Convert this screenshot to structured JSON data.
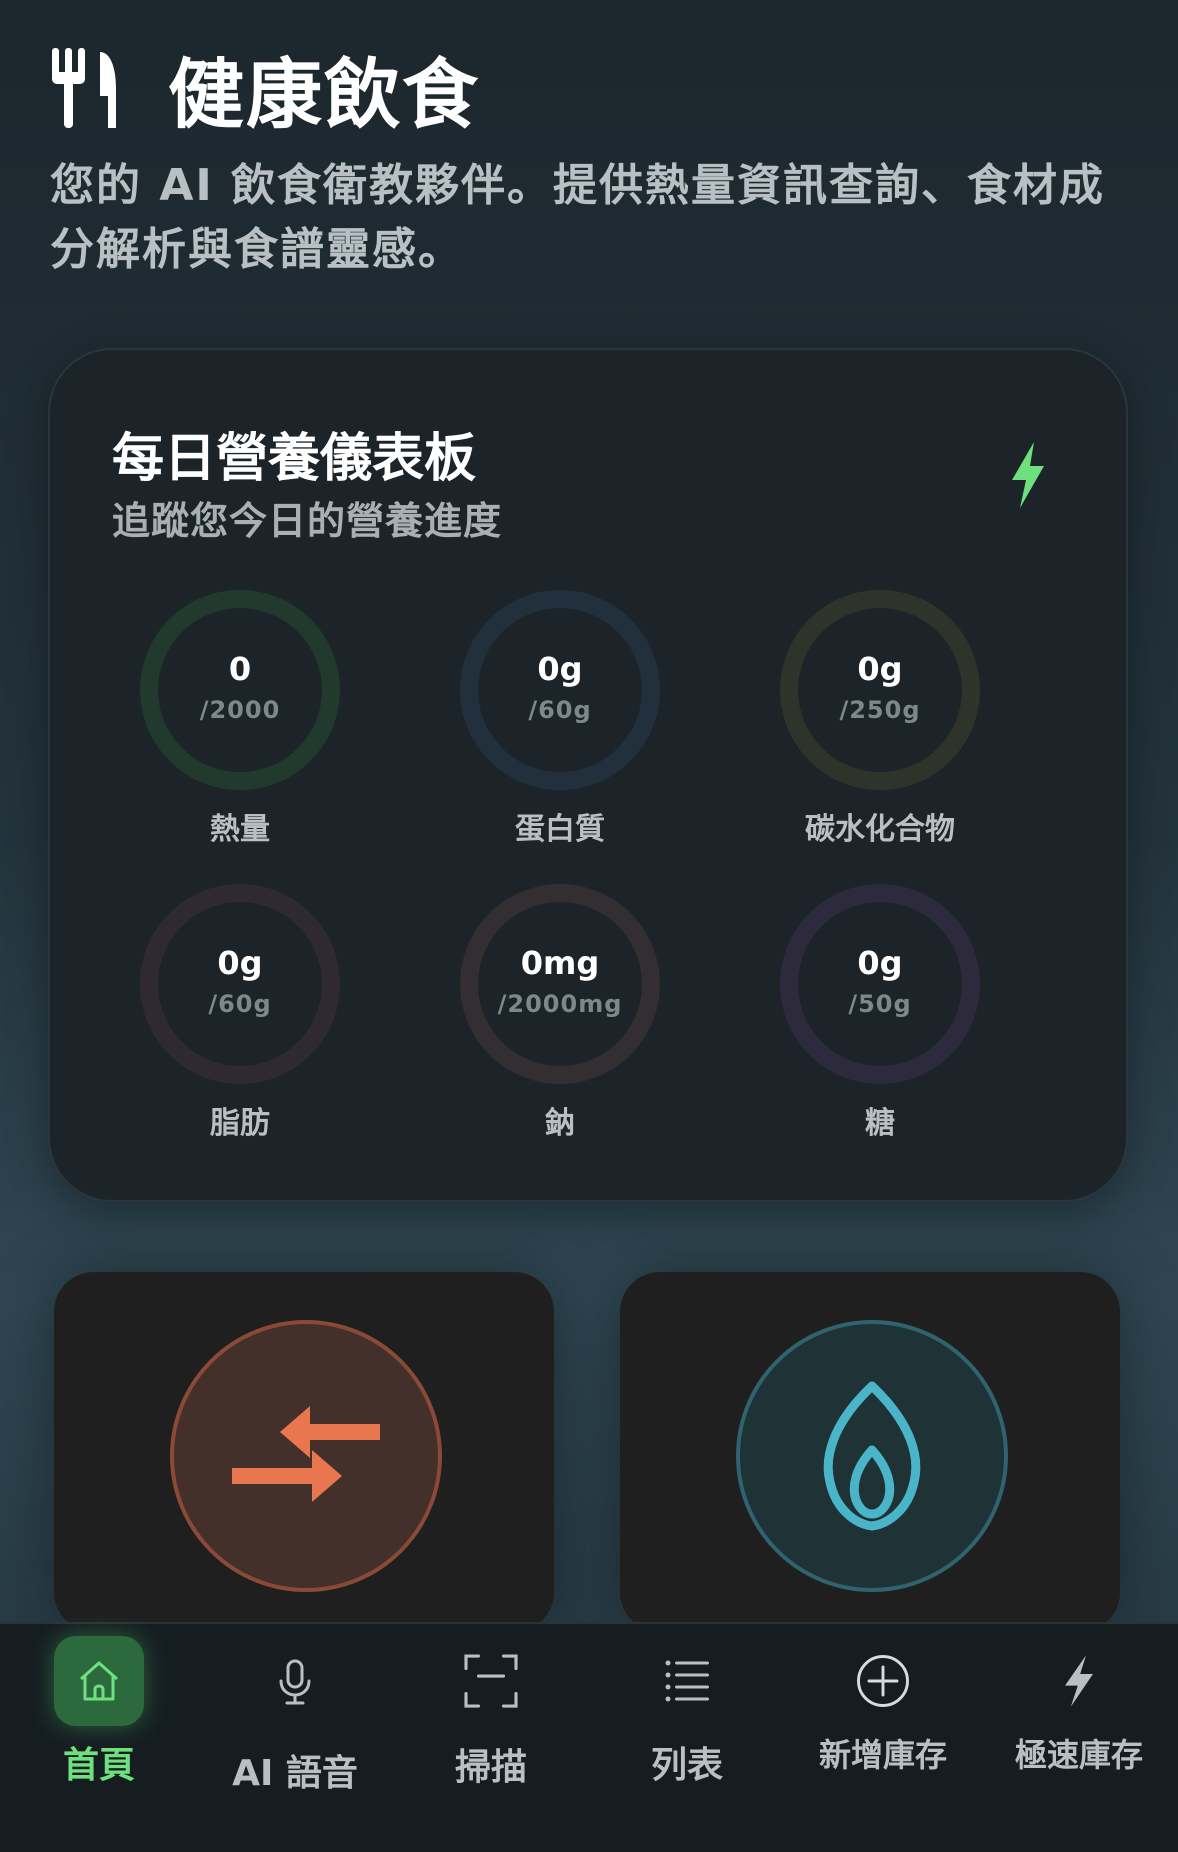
{
  "header": {
    "title": "健康飲食",
    "subtitle": "您的 AI 飲食衛教夥伴。提供熱量資訊查詢、食材成分解析與食譜靈感。"
  },
  "dashboard": {
    "title": "每日營養儀表板",
    "subtitle": "追蹤您今日的營養進度",
    "metrics": [
      {
        "value": "0",
        "goal": "/2000",
        "label": "熱量",
        "color": "#22392e"
      },
      {
        "value": "0g",
        "goal": "/60g",
        "label": "蛋白質",
        "color": "#21303c"
      },
      {
        "value": "0g",
        "goal": "/250g",
        "label": "碳水化合物",
        "color": "#2f342b"
      },
      {
        "value": "0g",
        "goal": "/60g",
        "label": "脂肪",
        "color": "#2f2a31"
      },
      {
        "value": "0mg",
        "goal": "/2000mg",
        "label": "鈉",
        "color": "#332e31"
      },
      {
        "value": "0g",
        "goal": "/50g",
        "label": "糖",
        "color": "#2d2a3d"
      }
    ]
  },
  "colors": {
    "accent_green": "#6ee07e",
    "swap_orange": "#e8764f",
    "flame_blue": "#4ab5c9"
  },
  "cards": [
    {
      "icon": "swap-arrows-icon"
    },
    {
      "icon": "flame-icon"
    }
  ],
  "nav": [
    {
      "label": "首頁",
      "icon": "home-icon",
      "active": true
    },
    {
      "label": "AI 語音",
      "icon": "microphone-icon",
      "active": false
    },
    {
      "label": "掃描",
      "icon": "scan-icon",
      "active": false
    },
    {
      "label": "列表",
      "icon": "list-icon",
      "active": false
    },
    {
      "label": "新增庫存",
      "icon": "add-circle-icon",
      "active": false
    },
    {
      "label": "極速庫存",
      "icon": "bolt-icon",
      "active": false
    }
  ]
}
